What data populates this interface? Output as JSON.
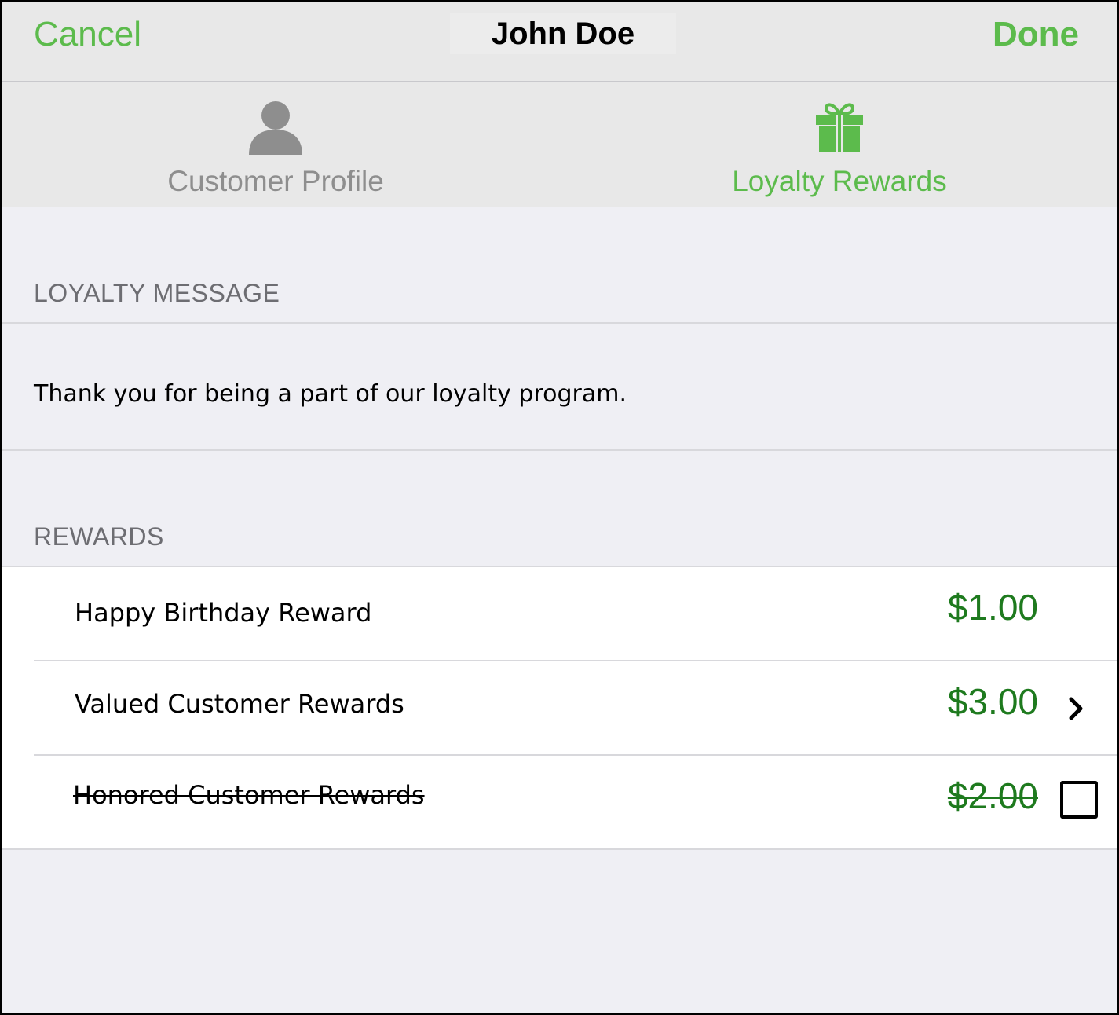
{
  "navbar": {
    "cancel_label": "Cancel",
    "title": "John Doe",
    "done_label": "Done"
  },
  "tabs": [
    {
      "label": "Customer Profile",
      "icon": "person-icon",
      "selected": false
    },
    {
      "label": "Loyalty Rewards",
      "icon": "gift-icon",
      "selected": true
    }
  ],
  "loyalty_message": {
    "header": "LOYALTY MESSAGE",
    "text": "Thank you for being a part of our loyalty program."
  },
  "rewards": {
    "header": "REWARDS",
    "items": [
      {
        "name": "Happy Birthday Reward",
        "amount": "$1.00",
        "struck": false,
        "accessory": "none"
      },
      {
        "name": "Valued Customer Rewards",
        "amount": "$3.00",
        "struck": false,
        "accessory": "chevron-right-icon"
      },
      {
        "name": "Honored Customer Rewards",
        "amount": "$2.00",
        "struck": true,
        "accessory": "checkbox"
      }
    ]
  },
  "colors": {
    "accent_green": "#5cbb4c",
    "amount_green": "#1e7a1e",
    "inactive_gray": "#8e8e8e",
    "background": "#efeff4"
  }
}
